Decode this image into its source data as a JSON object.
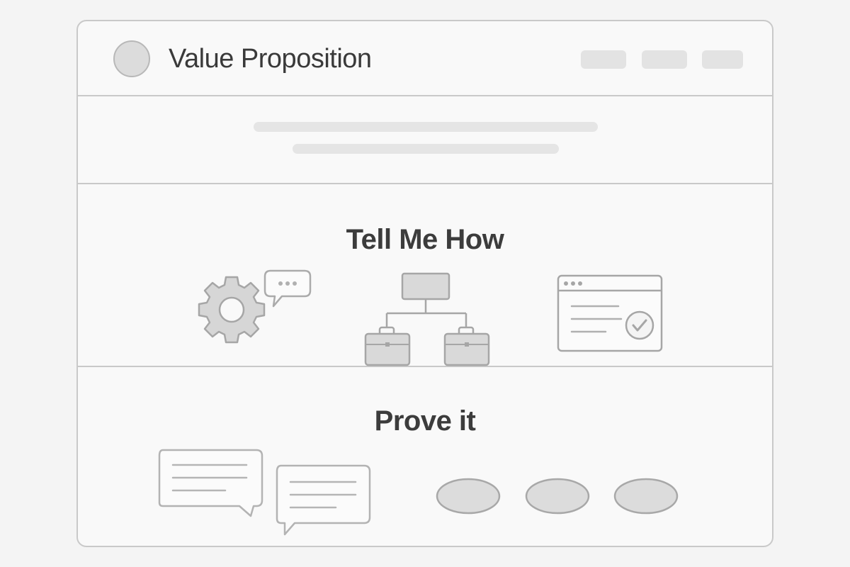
{
  "header": {
    "title": "Value Proposition",
    "avatar_icon": "avatar-placeholder",
    "nav_items": [
      "nav-placeholder-1",
      "nav-placeholder-2",
      "nav-placeholder-3"
    ]
  },
  "hero": {
    "text_lines": [
      "text-placeholder-1",
      "text-placeholder-2"
    ]
  },
  "tell_me_how": {
    "title": "Tell Me How",
    "icons": [
      "gear-icon",
      "chat-bubble-icon",
      "org-chart-icon",
      "browser-window-check-icon"
    ]
  },
  "prove_it": {
    "title": "Prove it",
    "icons": [
      "testimonial-bubble-icon",
      "testimonial-bubble-icon",
      "logo-placeholder",
      "logo-placeholder",
      "logo-placeholder"
    ]
  },
  "colors": {
    "border": "#c9c9c9",
    "placeholder_fill": "#e3e3e3",
    "icon_stroke": "#a8a8a8",
    "icon_fill": "#d8d8d8",
    "text": "#3a3a3a"
  }
}
